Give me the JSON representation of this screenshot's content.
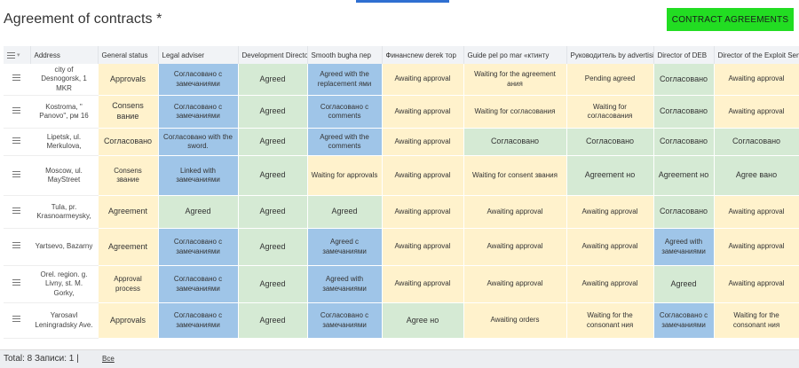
{
  "page": {
    "title": "Agreement of contracts *",
    "primary_button": "CONTRACT AGREEMENTS"
  },
  "colors": {
    "yellow": "#fff2cc",
    "green": "#d5ead4",
    "blue": "#9fc5e8",
    "accent": "#22dd22"
  },
  "table": {
    "columns": [
      "Address",
      "General status",
      "Legal adviser",
      "Development Director",
      "Smooth bugha  пер",
      "Финансnew derek   тор",
      "Guide     pel po mar    «ктинту",
      "Руководитель by advertising",
      "Director of DEB",
      "Director of the Exploit Service"
    ],
    "rows": [
      {
        "address": "city of Desnogorsk, 1 MKR",
        "cells": [
          {
            "text": "Approvals",
            "color": "yellow"
          },
          {
            "text": "Согласовано с замечаниями",
            "color": "blue"
          },
          {
            "text": "Agreed",
            "color": "green"
          },
          {
            "text": "Agreed with the replacement ями",
            "color": "blue"
          },
          {
            "text": "Awaiting approval",
            "color": "yellow"
          },
          {
            "text": "Waiting for the agreement ания",
            "color": "yellow"
          },
          {
            "text": "Pending agreed",
            "color": "yellow"
          },
          {
            "text": "Согласовано",
            "color": "green"
          },
          {
            "text": "Awaiting approval",
            "color": "yellow"
          }
        ]
      },
      {
        "address": "Kostroma, \" Panovo\", рм 16",
        "cells": [
          {
            "text": "Consens вание",
            "color": "yellow"
          },
          {
            "text": "Согласовано с замечаниями",
            "color": "blue"
          },
          {
            "text": "Agreed",
            "color": "green"
          },
          {
            "text": "Согласовано с comments",
            "color": "blue"
          },
          {
            "text": "Awaiting approval",
            "color": "yellow"
          },
          {
            "text": "Waiting for согласования",
            "color": "yellow"
          },
          {
            "text": "Waiting for согласования",
            "color": "yellow"
          },
          {
            "text": "Согласовано",
            "color": "green"
          },
          {
            "text": "Awaiting approval",
            "color": "yellow"
          }
        ]
      },
      {
        "address": "Lipetsk, ul. Merkulova,",
        "cells": [
          {
            "text": "Согласовано",
            "color": "yellow"
          },
          {
            "text": "Согласовано with the sword.",
            "color": "blue"
          },
          {
            "text": "Agreed",
            "color": "green"
          },
          {
            "text": "Agreed with the comments",
            "color": "blue"
          },
          {
            "text": "Awaiting approval",
            "color": "yellow"
          },
          {
            "text": "Согласовано",
            "color": "green"
          },
          {
            "text": "Согласовано",
            "color": "green"
          },
          {
            "text": "Согласовано",
            "color": "green"
          },
          {
            "text": "Согласовано",
            "color": "green"
          }
        ]
      },
      {
        "address": "Moscow, ul. MayStreet",
        "cells": [
          {
            "text": "Consens звание",
            "color": "yellow"
          },
          {
            "text": "Linked with замечаниями",
            "color": "blue"
          },
          {
            "text": "Agreed",
            "color": "green"
          },
          {
            "text": "Waiting for approvals",
            "color": "yellow"
          },
          {
            "text": "Awaiting approval",
            "color": "yellow"
          },
          {
            "text": "Waiting for consent звания",
            "color": "yellow"
          },
          {
            "text": "Agreement  но",
            "color": "green"
          },
          {
            "text": "Agreement  но",
            "color": "green"
          },
          {
            "text": "Agree   вано",
            "color": "green"
          }
        ]
      },
      {
        "address": "Tula, pr. Krasnoarmeysky,",
        "cells": [
          {
            "text": "Agreement",
            "color": "yellow"
          },
          {
            "text": "Agreed",
            "color": "green"
          },
          {
            "text": "Agreed",
            "color": "green"
          },
          {
            "text": "Agreed",
            "color": "green"
          },
          {
            "text": "Awaiting approval",
            "color": "yellow"
          },
          {
            "text": "Awaiting approval",
            "color": "yellow"
          },
          {
            "text": "Awaiting approval",
            "color": "yellow"
          },
          {
            "text": "Согласовано",
            "color": "green"
          },
          {
            "text": "Awaiting approval",
            "color": "yellow"
          }
        ]
      },
      {
        "address": "Yartsevo, Bazarny",
        "cells": [
          {
            "text": "Agreement",
            "color": "yellow"
          },
          {
            "text": "Согласовано с замечаниями",
            "color": "blue"
          },
          {
            "text": "Agreed",
            "color": "green"
          },
          {
            "text": "Agreed с замечаниями",
            "color": "blue"
          },
          {
            "text": "Awaiting approval",
            "color": "yellow"
          },
          {
            "text": "Awaiting approval",
            "color": "yellow"
          },
          {
            "text": "Awaiting approval",
            "color": "yellow"
          },
          {
            "text": "Agreed with замечаниями",
            "color": "blue"
          },
          {
            "text": "Awaiting approval",
            "color": "yellow"
          }
        ]
      },
      {
        "address": "Orel. region. g. Livny, st. M. Gorky,",
        "cells": [
          {
            "text": "Approval process",
            "color": "yellow"
          },
          {
            "text": "Согласовано с замечаниями",
            "color": "blue"
          },
          {
            "text": "Agreed",
            "color": "green"
          },
          {
            "text": "Agreed with замечаниями",
            "color": "blue"
          },
          {
            "text": "Awaiting approval",
            "color": "yellow"
          },
          {
            "text": "Awaiting approval",
            "color": "yellow"
          },
          {
            "text": "Awaiting approval",
            "color": "yellow"
          },
          {
            "text": "Agreed",
            "color": "green"
          },
          {
            "text": "Awaiting approval",
            "color": "yellow"
          }
        ]
      },
      {
        "address": "Yarosavl Leningradsky Ave.",
        "cells": [
          {
            "text": "Approvals",
            "color": "yellow"
          },
          {
            "text": "Согласовано с замечаниями",
            "color": "blue"
          },
          {
            "text": "Agreed",
            "color": "green"
          },
          {
            "text": "Согласовано с замечаниями",
            "color": "blue"
          },
          {
            "text": "Agree   но",
            "color": "green"
          },
          {
            "text": "Awaiting orders",
            "color": "yellow"
          },
          {
            "text": "Waiting for the consonant ния",
            "color": "yellow"
          },
          {
            "text": "Согласовано с замечаниями",
            "color": "blue"
          },
          {
            "text": "Waiting for the consonant ния",
            "color": "yellow"
          }
        ]
      }
    ]
  },
  "footer": {
    "total": "Total: 8 Записи: 1 |",
    "all_link": "Все"
  }
}
